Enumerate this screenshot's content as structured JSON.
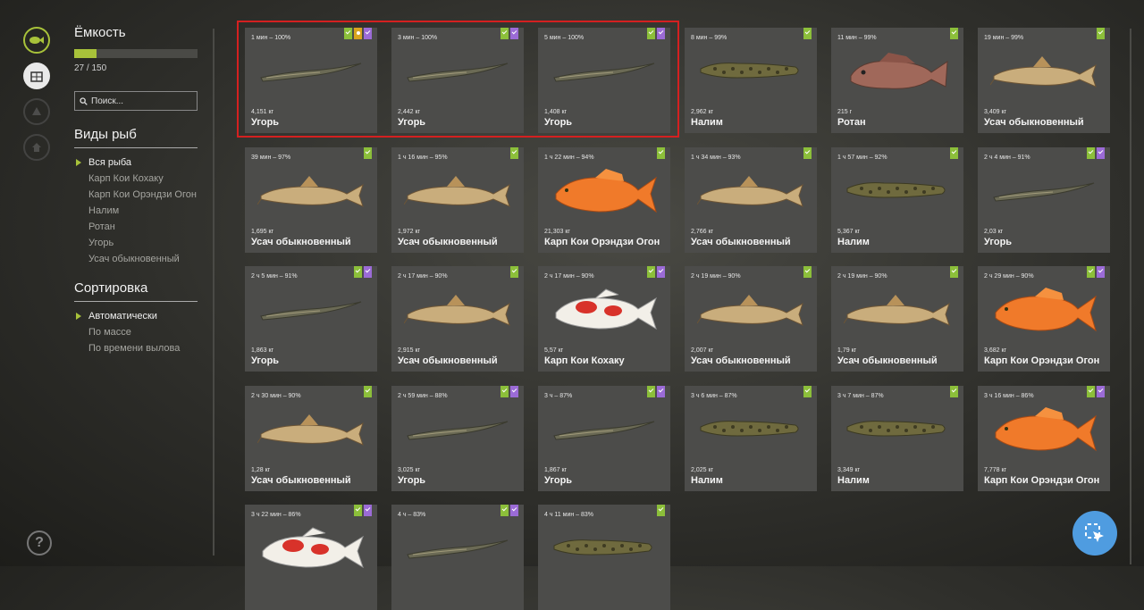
{
  "sidebar": {
    "capacity_title": "Ёмкость",
    "capacity_fraction": 0.18,
    "capacity_count": "27 / 150",
    "search_placeholder": "Поиск...",
    "species_title": "Виды рыб",
    "species": [
      "Вся рыба",
      "Карп Кои Кохаку",
      "Карп Кои Орэндзи Огон",
      "Налим",
      "Ротан",
      "Угорь",
      "Усач обыкновенный"
    ],
    "sort_title": "Сортировка",
    "sort_options": [
      "Автоматически",
      "По массе",
      "По времени вылова"
    ]
  },
  "colors": {
    "accent": "#a8c23a",
    "highlight": "#d42020",
    "badge_green": "#8cbf3a",
    "badge_purple": "#9b6bd6",
    "badge_yellow": "#d9a41f",
    "fab": "#4f9ce0"
  },
  "cards": [
    {
      "time": "1 мин – 100%",
      "weight": "4,151 кг",
      "name": "Угорь",
      "fish": "eel",
      "badges": [
        "green",
        "yellow",
        "purple"
      ]
    },
    {
      "time": "3 мин – 100%",
      "weight": "2,442 кг",
      "name": "Угорь",
      "fish": "eel",
      "badges": [
        "green",
        "purple"
      ]
    },
    {
      "time": "5 мин – 100%",
      "weight": "1,408 кг",
      "name": "Угорь",
      "fish": "eel",
      "badges": [
        "green",
        "purple"
      ]
    },
    {
      "time": "8 мин – 99%",
      "weight": "2,962 кг",
      "name": "Налим",
      "fish": "burbot",
      "badges": [
        "green"
      ]
    },
    {
      "time": "11 мин – 99%",
      "weight": "215 г",
      "name": "Ротан",
      "fish": "rotan",
      "badges": [
        "green"
      ]
    },
    {
      "time": "19 мин – 99%",
      "weight": "3,409 кг",
      "name": "Усач обыкновенный",
      "fish": "barbel",
      "badges": [
        "green"
      ]
    },
    {
      "time": "39 мин – 97%",
      "weight": "1,695 кг",
      "name": "Усач обыкновенный",
      "fish": "barbel",
      "badges": [
        "green"
      ]
    },
    {
      "time": "1 ч 16 мин – 95%",
      "weight": "1,972 кг",
      "name": "Усач обыкновенный",
      "fish": "barbel",
      "badges": [
        "green"
      ]
    },
    {
      "time": "1 ч 22 мин – 94%",
      "weight": "21,303 кг",
      "name": "Карп Кои Орэндзи Огон",
      "fish": "koi_orange",
      "badges": [
        "green"
      ]
    },
    {
      "time": "1 ч 34 мин – 93%",
      "weight": "2,766 кг",
      "name": "Усач обыкновенный",
      "fish": "barbel",
      "badges": [
        "green"
      ]
    },
    {
      "time": "1 ч 57 мин – 92%",
      "weight": "5,367 кг",
      "name": "Налим",
      "fish": "burbot",
      "badges": [
        "green"
      ]
    },
    {
      "time": "2 ч 4 мин – 91%",
      "weight": "2,03 кг",
      "name": "Угорь",
      "fish": "eel",
      "badges": [
        "green",
        "purple"
      ]
    },
    {
      "time": "2 ч 5 мин – 91%",
      "weight": "1,863 кг",
      "name": "Угорь",
      "fish": "eel",
      "badges": [
        "green",
        "purple"
      ]
    },
    {
      "time": "2 ч 17 мин – 90%",
      "weight": "2,915 кг",
      "name": "Усач обыкновенный",
      "fish": "barbel",
      "badges": [
        "green"
      ]
    },
    {
      "time": "2 ч 17 мин – 90%",
      "weight": "5,57 кг",
      "name": "Карп Кои Кохаку",
      "fish": "koi_kohaku",
      "badges": [
        "green",
        "purple"
      ]
    },
    {
      "time": "2 ч 19 мин – 90%",
      "weight": "2,007 кг",
      "name": "Усач обыкновенный",
      "fish": "barbel",
      "badges": [
        "green"
      ]
    },
    {
      "time": "2 ч 19 мин – 90%",
      "weight": "1,79 кг",
      "name": "Усач обыкновенный",
      "fish": "barbel",
      "badges": [
        "green"
      ]
    },
    {
      "time": "2 ч 29 мин – 90%",
      "weight": "3,682 кг",
      "name": "Карп Кои Орэндзи Огон",
      "fish": "koi_orange",
      "badges": [
        "green",
        "purple"
      ]
    },
    {
      "time": "2 ч 30 мин – 90%",
      "weight": "1,28 кг",
      "name": "Усач обыкновенный",
      "fish": "barbel",
      "badges": [
        "green"
      ]
    },
    {
      "time": "2 ч 59 мин – 88%",
      "weight": "3,025 кг",
      "name": "Угорь",
      "fish": "eel",
      "badges": [
        "green",
        "purple"
      ]
    },
    {
      "time": "3 ч – 87%",
      "weight": "1,867 кг",
      "name": "Угорь",
      "fish": "eel",
      "badges": [
        "green",
        "purple"
      ]
    },
    {
      "time": "3 ч 6 мин – 87%",
      "weight": "2,025 кг",
      "name": "Налим",
      "fish": "burbot",
      "badges": [
        "green"
      ]
    },
    {
      "time": "3 ч 7 мин – 87%",
      "weight": "3,349 кг",
      "name": "Налим",
      "fish": "burbot",
      "badges": [
        "green"
      ]
    },
    {
      "time": "3 ч 16 мин – 86%",
      "weight": "7,778 кг",
      "name": "Карп Кои Орэндзи Огон",
      "fish": "koi_orange",
      "badges": [
        "green",
        "purple"
      ]
    },
    {
      "time": "3 ч 22 мин – 86%",
      "weight": "",
      "name": "",
      "fish": "koi_kohaku",
      "badges": [
        "green",
        "purple"
      ]
    },
    {
      "time": "4 ч – 83%",
      "weight": "",
      "name": "",
      "fish": "eel",
      "badges": [
        "green",
        "purple"
      ]
    },
    {
      "time": "4 ч 11 мин – 83%",
      "weight": "",
      "name": "",
      "fish": "burbot",
      "badges": [
        "green"
      ]
    }
  ]
}
